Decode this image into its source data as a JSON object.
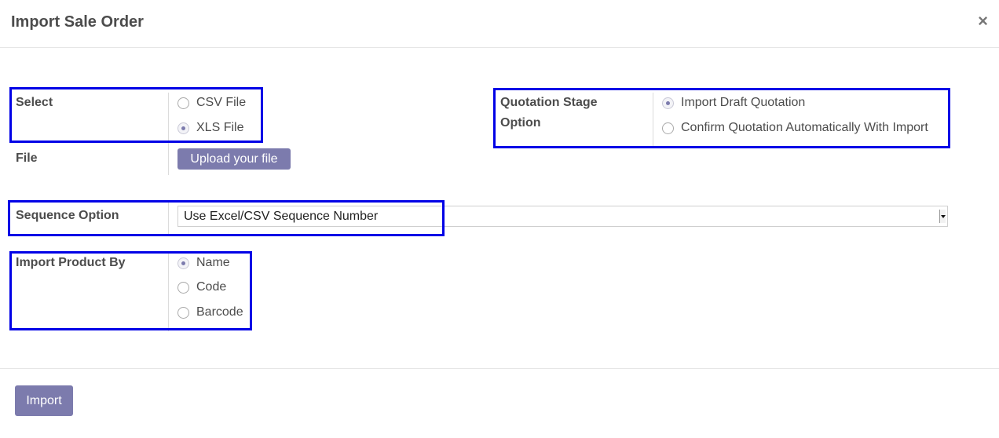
{
  "dialog": {
    "title": "Import Sale Order",
    "close_label": "×"
  },
  "select_field": {
    "label": "Select",
    "options": [
      {
        "label": "CSV File",
        "checked": false
      },
      {
        "label": "XLS File",
        "checked": true
      }
    ]
  },
  "file_field": {
    "label": "File",
    "upload_label": "Upload your file"
  },
  "quotation_stage": {
    "label_line1": "Quotation Stage",
    "label_line2": "Option",
    "options": [
      {
        "label": "Import Draft Quotation",
        "checked": true
      },
      {
        "label": "Confirm Quotation Automatically With Import",
        "checked": false
      }
    ]
  },
  "sequence_option": {
    "label": "Sequence Option",
    "selected": "Use Excel/CSV Sequence Number"
  },
  "import_product_by": {
    "label": "Import Product By",
    "options": [
      {
        "label": "Name",
        "checked": true
      },
      {
        "label": "Code",
        "checked": false
      },
      {
        "label": "Barcode",
        "checked": false
      }
    ]
  },
  "footer": {
    "import_label": "Import"
  },
  "colors": {
    "accent": "#7c7bad",
    "highlight_box": "#0000e6"
  }
}
